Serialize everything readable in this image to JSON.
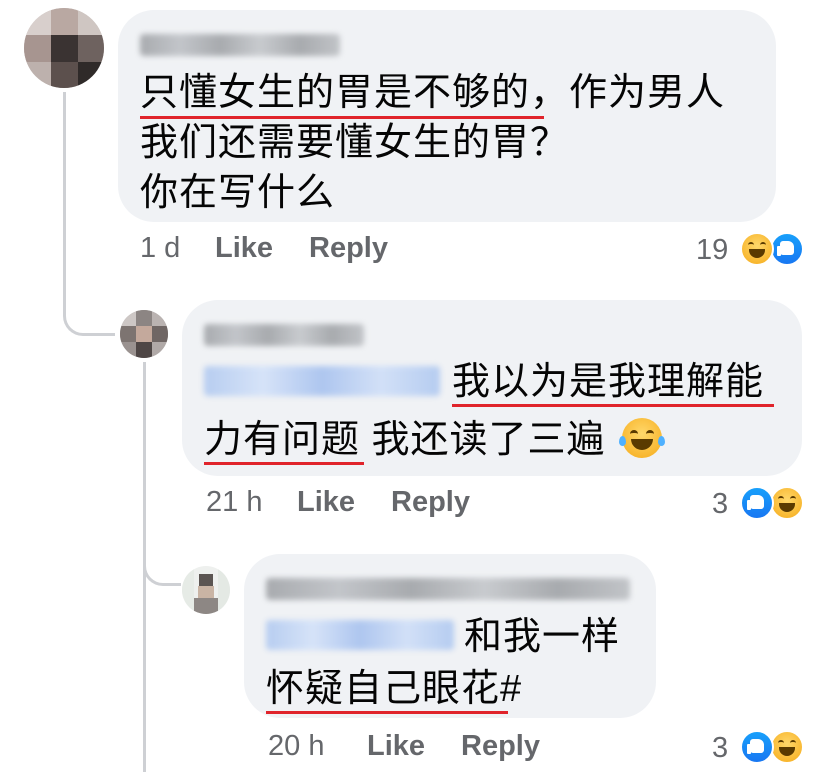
{
  "comments": [
    {
      "author": "Xander Wong",
      "lines": [
        "只懂女生的胃是不够的，作为男人",
        "我们还需要懂女生的胃？",
        "你在写什么"
      ],
      "time": "1 d",
      "like": "Like",
      "reply": "Reply",
      "reaction_count": "19",
      "reactions": [
        "haha-emoji",
        "like-emoji"
      ]
    },
    {
      "author": "Jing Chua",
      "mention": "Xander Wong",
      "line1": "我以为是我理解能",
      "line2": "力有问题 我还读了三遍",
      "time": "21 h",
      "like": "Like",
      "reply": "Reply",
      "reaction_count": "3",
      "reactions": [
        "like-emoji",
        "haha-emoji"
      ]
    },
    {
      "author": "Lim Chun Kuan Nicholas",
      "mention": "Jing Chua",
      "line1": "和我一样",
      "line2": "怀疑自己眼花#",
      "time": "20 h",
      "like": "Like",
      "reply": "Reply",
      "reaction_count": "3",
      "reactions": [
        "like-emoji",
        "haha-emoji"
      ]
    }
  ],
  "colors": {
    "bubble": "#f0f2f5",
    "meta_text": "#65676b",
    "underline": "#e0242b",
    "like_blue": "#1877f2",
    "haha_yellow": "#f7b125",
    "thread_line": "#ced0d4"
  }
}
